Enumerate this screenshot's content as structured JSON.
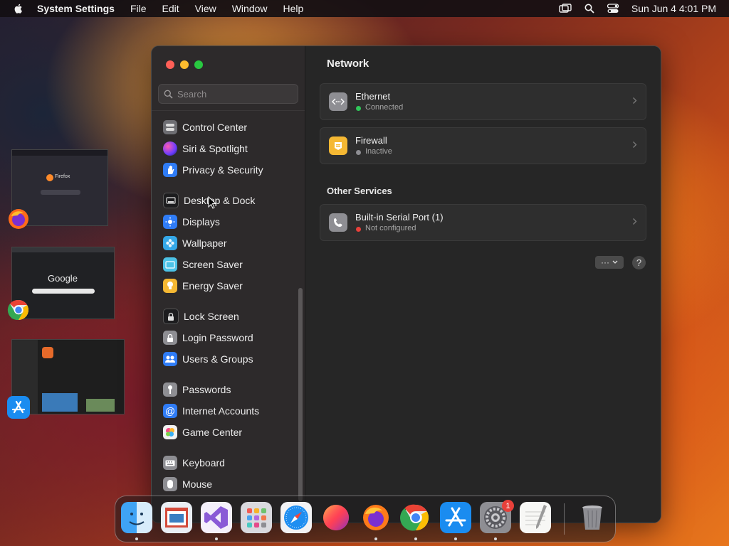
{
  "menubar": {
    "app_name": "System Settings",
    "menus": [
      "File",
      "Edit",
      "View",
      "Window",
      "Help"
    ],
    "clock": "Sun Jun 4  4:01 PM"
  },
  "sidebar": {
    "search_placeholder": "Search",
    "items": [
      {
        "label": "Control Center",
        "icon": "control-center-icon",
        "color": "#6e6e73"
      },
      {
        "label": "Siri & Spotlight",
        "icon": "siri-icon",
        "color": "#b04ad8"
      },
      {
        "label": "Privacy & Security",
        "icon": "hand-icon",
        "color": "#2f7cf6"
      },
      {
        "label": "Desktop & Dock",
        "icon": "dock-icon",
        "color": "#1c1c1e"
      },
      {
        "label": "Displays",
        "icon": "sun-icon",
        "color": "#2f7cf6"
      },
      {
        "label": "Wallpaper",
        "icon": "flower-icon",
        "color": "#35a8e8"
      },
      {
        "label": "Screen Saver",
        "icon": "screen-saver-icon",
        "color": "#4cc2e6"
      },
      {
        "label": "Energy Saver",
        "icon": "bulb-icon",
        "color": "#f5b833"
      },
      {
        "label": "Lock Screen",
        "icon": "lock-icon",
        "color": "#1c1c1e"
      },
      {
        "label": "Login Password",
        "icon": "lock-icon",
        "color": "#8e8e93"
      },
      {
        "label": "Users & Groups",
        "icon": "users-icon",
        "color": "#2f7cf6"
      },
      {
        "label": "Passwords",
        "icon": "key-icon",
        "color": "#8e8e93"
      },
      {
        "label": "Internet Accounts",
        "icon": "at-icon",
        "color": "#2f7cf6"
      },
      {
        "label": "Game Center",
        "icon": "game-center-icon",
        "color": "#e8e8e8"
      },
      {
        "label": "Keyboard",
        "icon": "keyboard-icon",
        "color": "#8e8e93"
      },
      {
        "label": "Mouse",
        "icon": "mouse-icon",
        "color": "#8e8e93"
      }
    ]
  },
  "main": {
    "title": "Network",
    "services": [
      {
        "name": "Ethernet",
        "status": "Connected",
        "status_color": "#30c85a",
        "icon": "ethernet-icon"
      },
      {
        "name": "Firewall",
        "status": "Inactive",
        "status_color": "#8e8e93",
        "icon": "firewall-icon"
      }
    ],
    "other_title": "Other Services",
    "other_services": [
      {
        "name": "Built-in Serial Port (1)",
        "status": "Not configured",
        "status_color": "#e8403a",
        "icon": "phone-icon"
      }
    ],
    "more_label": "···",
    "help_label": "?"
  },
  "dock": {
    "apps": [
      "Finder",
      "Preview",
      "Visual Studio",
      "Launchpad",
      "Safari",
      "Firefox Developer",
      "Firefox",
      "Chrome",
      "App Store",
      "System Settings",
      "TextEdit",
      "Trash"
    ],
    "settings_badge": "1"
  },
  "thumbnails": {
    "firefox_label": "Firefox",
    "google_label": "Google"
  }
}
